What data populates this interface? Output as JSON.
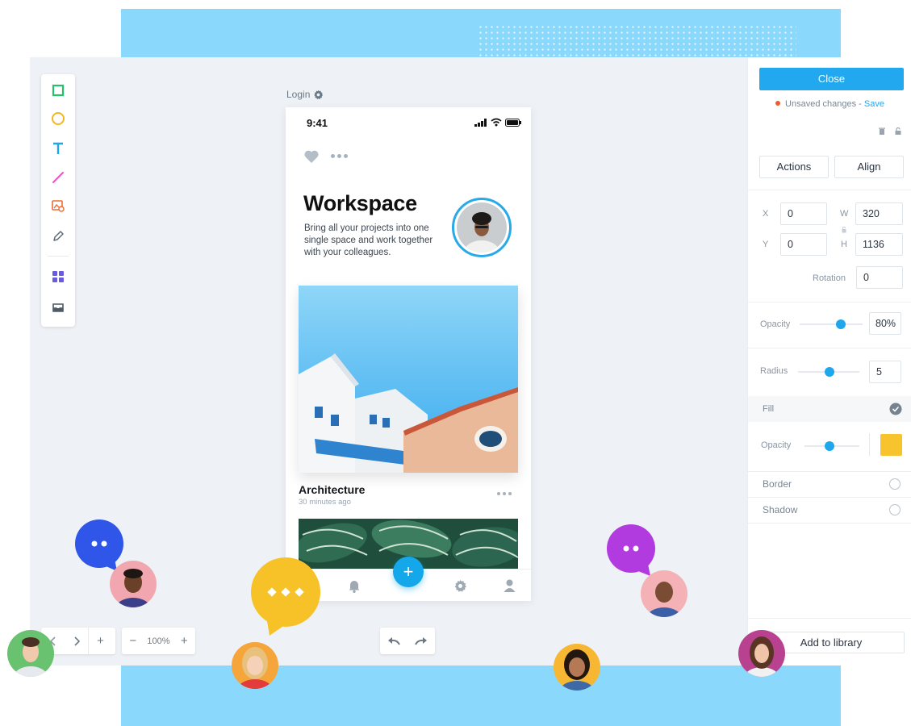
{
  "artboard": {
    "name": "Login"
  },
  "phone": {
    "time": "9:41",
    "title": "Workspace",
    "description": "Bring all your projects into one single space and work together with your colleagues.",
    "card": {
      "title": "Architecture",
      "subtitle": "30 minutes ago"
    },
    "fab_label": "+"
  },
  "zoom": {
    "value": "100%",
    "minus": "−",
    "plus": "+",
    "add": "+"
  },
  "panel": {
    "close_label": "Close",
    "unsaved_text": "Unsaved changes - ",
    "save_label": "Save",
    "actions_label": "Actions",
    "align_label": "Align",
    "x_label": "X",
    "x_value": "0",
    "y_label": "Y",
    "y_value": "0",
    "w_label": "W",
    "w_value": "320",
    "h_label": "H",
    "h_value": "1136",
    "rotation_label": "Rotation",
    "rotation_value": "0",
    "opacity_label": "Opacity",
    "opacity_value": "80%",
    "opacity_level": 0.65,
    "radius_label": "Radius",
    "radius_value": "5",
    "fill_label": "Fill",
    "fill_opacity_label": "Opacity",
    "fill_color": "#f8c42e",
    "border_label": "Border",
    "shadow_label": "Shadow",
    "add_library_label": "Add to library"
  },
  "colors": {
    "accent": "#21a8ee",
    "background_band": "#8ad8fb",
    "unsaved_dot": "#f05b2b"
  }
}
